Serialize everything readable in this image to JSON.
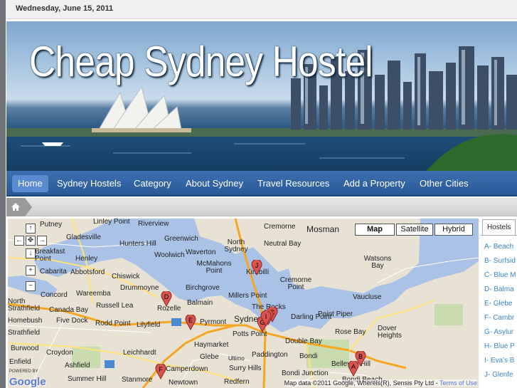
{
  "date": "Wednesday, June 15, 2011",
  "header": {
    "title": "Cheap Sydney Hostel"
  },
  "nav": {
    "items": [
      "Home",
      "Sydney Hostels",
      "Category",
      "About Sydney",
      "Travel Resources",
      "Add a Property",
      "Other Cities"
    ],
    "active_index": 0
  },
  "breadcrumb": {
    "home_icon": "home-icon"
  },
  "map": {
    "types": [
      "Map",
      "Satellite",
      "Hybrid"
    ],
    "selected_type": "Map",
    "controls": {
      "up": "↑",
      "left": "←",
      "center": "✥",
      "right": "→",
      "down": "↓",
      "zoom_in": "+",
      "zoom_out": "−"
    },
    "labels": [
      "Putney",
      "Linley Point",
      "Riverview",
      "Cremorne",
      "Mosman",
      "Gladesville",
      "Hunters Hill",
      "Greenwich",
      "North Sydney",
      "Neutral Bay",
      "Breakfast Point",
      "Henley",
      "Woolwich",
      "Waverton",
      "Watsons Bay",
      "Cabarita",
      "Abbotsford",
      "McMahons Point",
      "Kirribilli",
      "Chiswick",
      "Cremorne Point",
      "Birchgrove",
      "Drummoyne",
      "Concord",
      "Wareemba",
      "Millers Point",
      "Vaucluse",
      "North Strathfield",
      "Canada Bay",
      "Russell Lea",
      "Rozelle",
      "Balmain",
      "The Rocks",
      "Homebush",
      "Five Dock",
      "Rodd Point",
      "Lilyfield",
      "Pyrmont",
      "Sydney",
      "Darling Point",
      "Point Piper",
      "Strathfield",
      "Potts Point",
      "Rose Bay",
      "Dover Heights",
      "Burwood",
      "Haymarket",
      "Double Bay",
      "Croydon",
      "Leichhardt",
      "Glebe",
      "Ultimo",
      "Paddington",
      "Bondi",
      "Bellevue Hill",
      "Enfield",
      "Ashfield",
      "Camperdown",
      "Surry Hills",
      "Summer Hill",
      "Stanmore",
      "Newtown",
      "Redfern",
      "Bondi Junction",
      "Bondi Beach"
    ],
    "markers": [
      "A",
      "B",
      "C",
      "D",
      "E",
      "F",
      "G",
      "H",
      "I",
      "J"
    ],
    "copyright": "Map data ©2011 Google, Whereis(R), Sensis Pty Ltd -",
    "terms": "Terms of Use",
    "powered_by": "POWERED BY",
    "logo": "Google"
  },
  "sidebar": {
    "tab": "Hostels",
    "items": [
      "A- Beach",
      "B- Surfsid",
      "C- Blue M",
      "D- Balma",
      "E- Glebe",
      "F- Cambr",
      "G- Asylur",
      "H- Blue P",
      "I- Eva's B",
      "J- Glenfe"
    ]
  },
  "colors": {
    "nav_bg": "#2f619f",
    "nav_active": "#5a8ad0",
    "link": "#3a86c8",
    "marker": "#d9534f"
  }
}
